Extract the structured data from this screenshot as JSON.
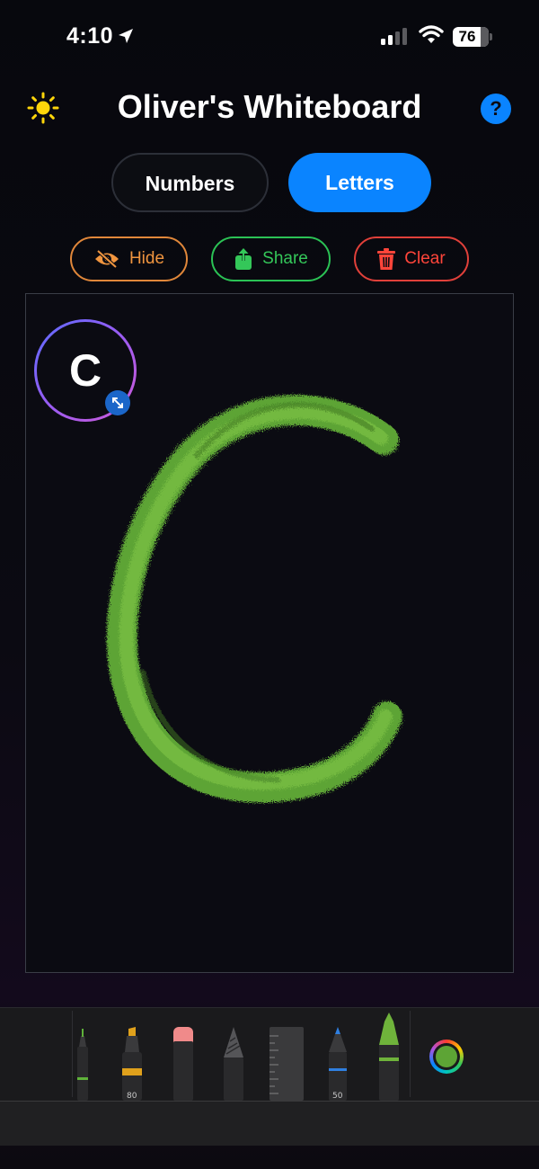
{
  "status": {
    "time": "4:10",
    "battery": "76"
  },
  "header": {
    "title": "Oliver's Whiteboard",
    "help": "?"
  },
  "mode_tabs": [
    {
      "label": "Numbers",
      "selected": false
    },
    {
      "label": "Letters",
      "selected": true
    }
  ],
  "actions": {
    "hide": "Hide",
    "share": "Share",
    "clear": "Clear"
  },
  "canvas": {
    "target_letter": "C",
    "stroke_color": "#6fb33b"
  },
  "tools": [
    {
      "name": "pen",
      "accent": "#5fb23a"
    },
    {
      "name": "marker",
      "accent": "#e0a11c",
      "value": "80"
    },
    {
      "name": "eraser",
      "accent": "#f08a8a"
    },
    {
      "name": "pencil",
      "accent": "#888888"
    },
    {
      "name": "ruler",
      "accent": "#555555"
    },
    {
      "name": "fountain-pen",
      "accent": "#2f7fe0",
      "value": "50"
    },
    {
      "name": "crayon",
      "accent": "#6fb33b"
    }
  ],
  "current_color": "#5da435",
  "colors": {
    "accent": "#0a84ff",
    "hide": "#f0953f",
    "share": "#34c759",
    "clear": "#ff453a"
  }
}
